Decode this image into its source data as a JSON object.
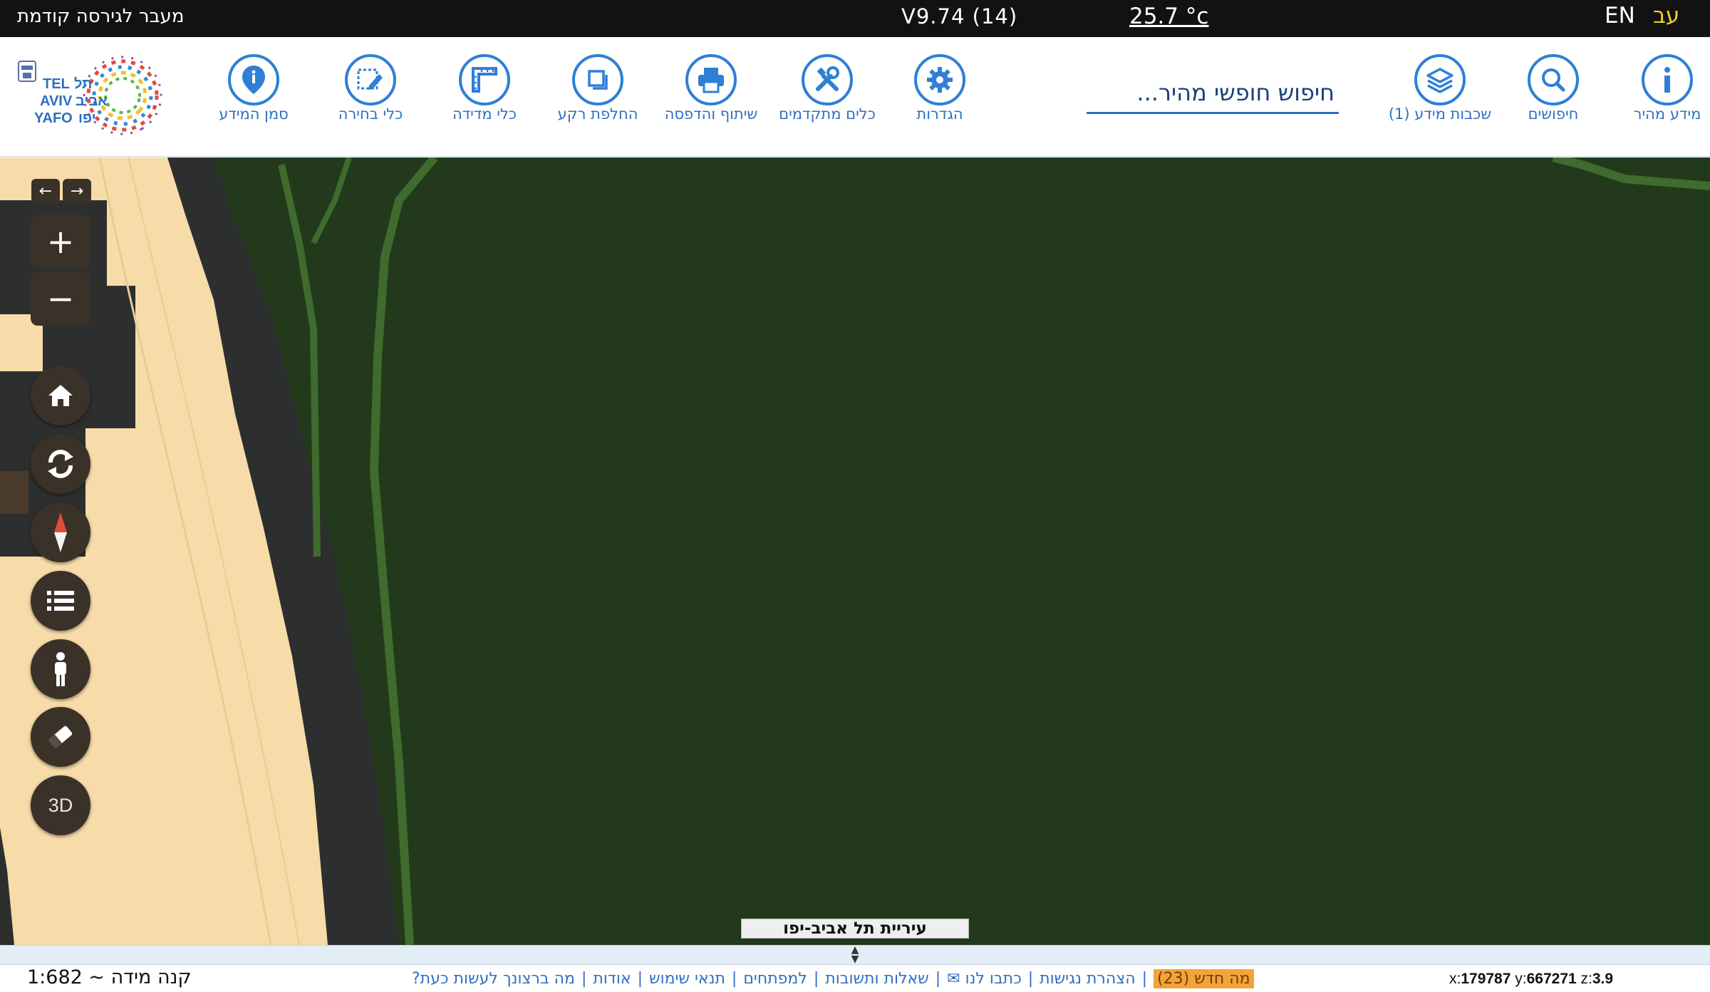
{
  "topbar": {
    "prev_version_link": "מעבר לגירסה קודמת",
    "version": "V9.74 (14)",
    "temperature": "25.7 °c",
    "lang_en": "EN",
    "lang_he": "עב"
  },
  "logo": {
    "text_lines": [
      "TEL",
      "תל",
      "AVIV",
      "אביב",
      "YAFO",
      "יפו"
    ]
  },
  "toolbar": {
    "tools": [
      {
        "label": "סמן המידע",
        "icon": "map-pin-icon"
      },
      {
        "label": "כלי בחירה",
        "icon": "selection-pencil-icon"
      },
      {
        "label": "כלי מדידה",
        "icon": "ruler-icon"
      },
      {
        "label": "החלפת רקע",
        "icon": "background-switch-icon"
      },
      {
        "label": "שיתוף והדפסה",
        "icon": "printer-icon"
      },
      {
        "label": "כלים מתקדמים",
        "icon": "tools-icon"
      },
      {
        "label": "הגדרות",
        "icon": "gear-icon"
      },
      {
        "label": "שכבות מידע (1)",
        "icon": "layers-icon"
      },
      {
        "label": "חיפושים",
        "icon": "search-icon"
      },
      {
        "label": "מידע מהיר",
        "icon": "info-icon"
      }
    ],
    "search_placeholder": "חיפוש חופשי מהיר..."
  },
  "map": {
    "background_color": "#22391b",
    "beach_color": "#f7dca9",
    "coast_color": "#2d2f2f",
    "accent_green": "#3f6b2e",
    "controls": {
      "back_icon": "arrow-left-icon",
      "forward_icon": "arrow-right-icon",
      "zoom_in_label": "+",
      "zoom_out_label": "−",
      "btn_3d_label": "3D"
    },
    "city_label": "עיריית תל אביב-יפו"
  },
  "footer": {
    "scale": "קנה מידה ~ 1:682",
    "links": [
      "מה ברצונך לעשות כעת?",
      "אודות",
      "תנאי שימוש",
      "למפתחים",
      "שאלות ותשובות",
      "כתבו לנו ✉",
      "הצהרת נגישות"
    ],
    "whats_new": "מה חדש (23)",
    "coords": {
      "x_label": "x:",
      "x_value": "179787",
      "y_label": "y:",
      "y_value": "667271",
      "z_label": "z:",
      "z_value": "3.9"
    }
  }
}
